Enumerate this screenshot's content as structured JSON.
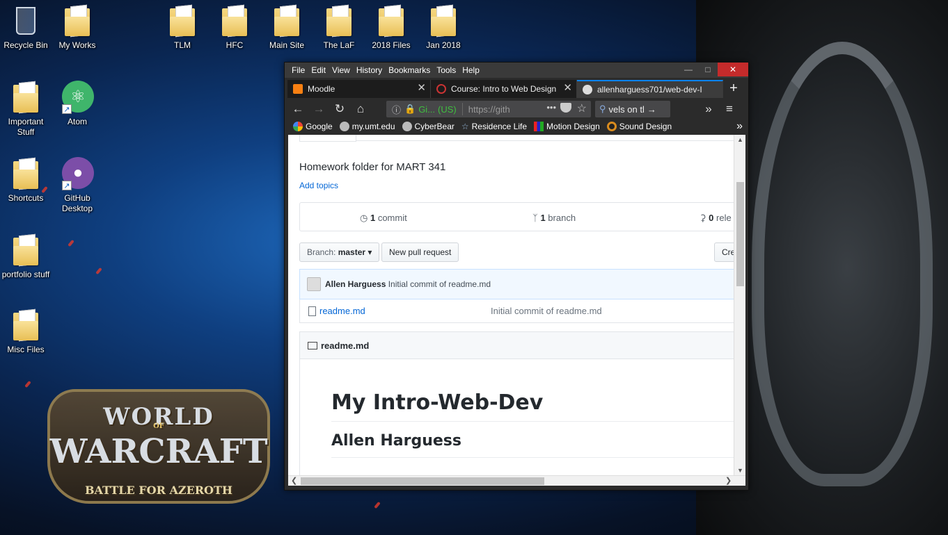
{
  "desktop": {
    "icons": [
      {
        "label": "Recycle Bin"
      },
      {
        "label": "My Works"
      },
      {
        "label": "TLM"
      },
      {
        "label": "HFC"
      },
      {
        "label": "Main Site"
      },
      {
        "label": "The LaF"
      },
      {
        "label": "2018 Files"
      },
      {
        "label": "Jan 2018"
      },
      {
        "label": "Important Stuff"
      },
      {
        "label": "Atom"
      },
      {
        "label": "Shortcuts"
      },
      {
        "label": "GitHub Desktop"
      },
      {
        "label": "portfolio stuff"
      },
      {
        "label": "Misc Files"
      }
    ],
    "wallpaper": {
      "logo_line1": "WORLD",
      "logo_of": "OF",
      "logo_line2": "WARCRAFT",
      "logo_line3": "BATTLE FOR AZEROTH"
    }
  },
  "browser": {
    "menu": [
      "File",
      "Edit",
      "View",
      "History",
      "Bookmarks",
      "Tools",
      "Help"
    ],
    "tabs": [
      {
        "title": "Moodle"
      },
      {
        "title": "Course: Intro to Web Design"
      },
      {
        "title": "allenharguess701/web-dev-I"
      }
    ],
    "urlbar": {
      "site_short": "Gi...",
      "country": "(US)",
      "url": "https://gith"
    },
    "search_text": "vels on tl",
    "bookmarks": [
      "Google",
      "my.umt.edu",
      "CyberBear",
      "Residence Life",
      "Motion Design",
      "Sound Design"
    ],
    "colors": {
      "accent": "#0a84ff",
      "close": "#c42b2b",
      "secure": "#3fbf3f"
    }
  },
  "page": {
    "description": "Homework folder for MART 341",
    "add_topics": "Add topics",
    "commits_count": "1",
    "commits_label": "commit",
    "branches_count": "1",
    "branches_label": "branch",
    "releases_count": "0",
    "releases_label": "rele",
    "branch_prefix": "Branch:",
    "branch_name": "master",
    "new_pr": "New pull request",
    "create_partial": "Cre",
    "latest_commit_author": "Allen Harguess",
    "latest_commit_message": "Initial commit of readme.md",
    "files": [
      {
        "name": "readme.md",
        "message": "Initial commit of readme.md"
      }
    ],
    "readme_title": "readme.md",
    "readme_h1": "My Intro-Web-Dev",
    "readme_h2": "Allen Harguess",
    "colors": {
      "link": "#0366d6",
      "text": "#24292e"
    }
  }
}
